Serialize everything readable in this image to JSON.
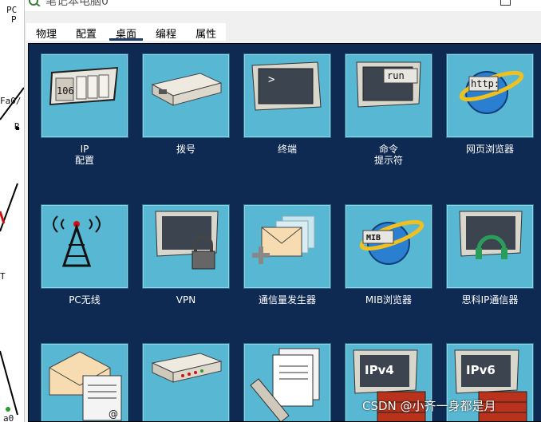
{
  "window": {
    "title": "笔记本电脑0"
  },
  "background": {
    "labels": [
      "PC",
      "P",
      "Fa0/",
      "R",
      "T",
      "a0"
    ]
  },
  "tabs": [
    {
      "label": "物理"
    },
    {
      "label": "配置"
    },
    {
      "label": "桌面",
      "active": true
    },
    {
      "label": "编程"
    },
    {
      "label": "属性"
    }
  ],
  "apps": [
    {
      "label": "IP\n配置",
      "icon": "ip-config-icon",
      "icon_text": "106"
    },
    {
      "label": "拨号",
      "icon": "modem-icon"
    },
    {
      "label": "终端",
      "icon": "terminal-icon",
      "icon_text": ">"
    },
    {
      "label": "命令\n提示符",
      "icon": "command-prompt-icon",
      "icon_text": "run"
    },
    {
      "label": "网页浏览器",
      "icon": "web-browser-icon",
      "icon_text": "http:"
    },
    {
      "label": "PC无线",
      "icon": "wireless-tower-icon"
    },
    {
      "label": "VPN",
      "icon": "vpn-lock-icon"
    },
    {
      "label": "通信量发生器",
      "icon": "traffic-generator-icon"
    },
    {
      "label": "MIB浏览器",
      "icon": "mib-browser-icon",
      "icon_text": "MIB"
    },
    {
      "label": "思科IP通信器",
      "icon": "ip-communicator-icon"
    },
    {
      "label": "",
      "icon": "email-icon",
      "icon_text": "@"
    },
    {
      "label": "",
      "icon": "pppoe-dialer-icon"
    },
    {
      "label": "",
      "icon": "text-editor-icon"
    },
    {
      "label": "",
      "icon": "ipv4-firewall-icon",
      "icon_text": "IPv4"
    },
    {
      "label": "",
      "icon": "ipv6-firewall-icon",
      "icon_text": "IPv6"
    }
  ],
  "watermark": "CSDN @小齐一身都是月"
}
